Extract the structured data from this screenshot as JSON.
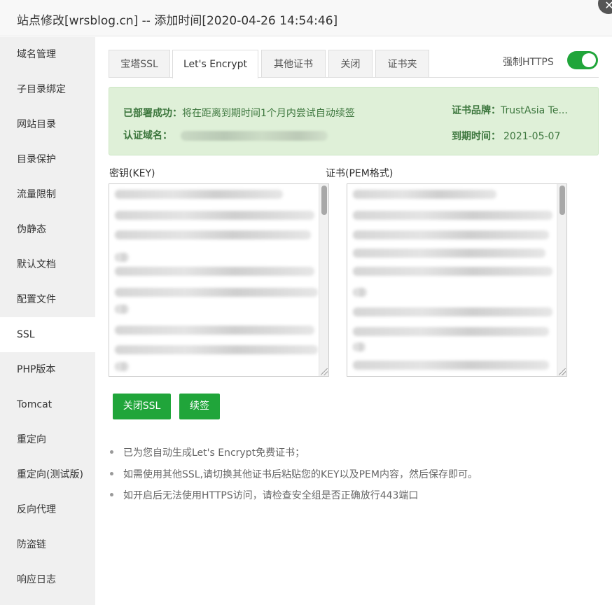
{
  "window": {
    "title": "站点修改[wrsblog.cn] -- 添加时间[2020-04-26 14:54:46]",
    "close_symbol": "✕"
  },
  "sidebar": {
    "items": [
      {
        "label": "域名管理"
      },
      {
        "label": "子目录绑定"
      },
      {
        "label": "网站目录"
      },
      {
        "label": "目录保护"
      },
      {
        "label": "流量限制"
      },
      {
        "label": "伪静态"
      },
      {
        "label": "默认文档"
      },
      {
        "label": "配置文件"
      },
      {
        "label": "SSL"
      },
      {
        "label": "PHP版本"
      },
      {
        "label": "Tomcat"
      },
      {
        "label": "重定向"
      },
      {
        "label": "重定向(测试版)"
      },
      {
        "label": "反向代理"
      },
      {
        "label": "防盗链"
      },
      {
        "label": "响应日志"
      }
    ],
    "active": "SSL"
  },
  "tabs": {
    "items": [
      {
        "label": "宝塔SSL"
      },
      {
        "label": "Let's Encrypt"
      },
      {
        "label": "其他证书"
      },
      {
        "label": "关闭"
      },
      {
        "label": "证书夹"
      }
    ],
    "active": "Let's Encrypt"
  },
  "force_https": {
    "label": "强制HTTPS",
    "enabled": true
  },
  "status": {
    "deployed_label": "已部署成功：",
    "deployed_text": "将在距离到期时间1个月内尝试自动续签",
    "domain_label": "认证域名：",
    "brand_label": "证书品牌：",
    "brand_value": "TrustAsia Te...",
    "expire_label": "到期时间：",
    "expire_value": "2021-05-07"
  },
  "fields": {
    "key_label": "密钥(KEY)",
    "cert_label": "证书(PEM格式)"
  },
  "buttons": {
    "close_ssl": "关闭SSL",
    "renew": "续签"
  },
  "tips": [
    "已为您自动生成Let's Encrypt免费证书；",
    "如需使用其他SSL,请切换其他证书后粘贴您的KEY以及PEM内容，然后保存即可。",
    "如开启后无法使用HTTPS访问，请检查安全组是否正确放行443端口"
  ],
  "colors": {
    "accent": "#20a53a",
    "alert_bg": "#dff0d8",
    "alert_text": "#3c763d"
  }
}
